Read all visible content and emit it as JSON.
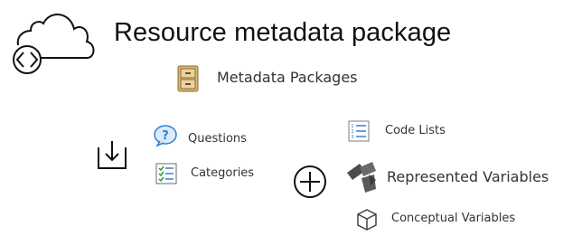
{
  "title": "Resource metadata package",
  "metadata_packages": {
    "label": "Metadata Packages",
    "icon": "filing-cabinet-icon"
  },
  "left_group": {
    "icon": "download-tray-icon",
    "items": [
      {
        "label": "Questions",
        "icon": "question-bubble-icon"
      },
      {
        "label": "Categories",
        "icon": "checklist-icon"
      }
    ]
  },
  "right_group": {
    "icon": "plus-circle-icon",
    "items": [
      {
        "label": "Code Lists",
        "icon": "numbered-list-icon"
      },
      {
        "label": "Represented Variables",
        "icon": "variable-shapes-icon"
      },
      {
        "label": "Conceptual Variables",
        "icon": "cube-icon"
      }
    ]
  },
  "colors": {
    "text": "#333333",
    "question_blue": "#2f7fd6",
    "list_blue": "#3a7bd5",
    "cabinet_tan": "#c7a468"
  }
}
